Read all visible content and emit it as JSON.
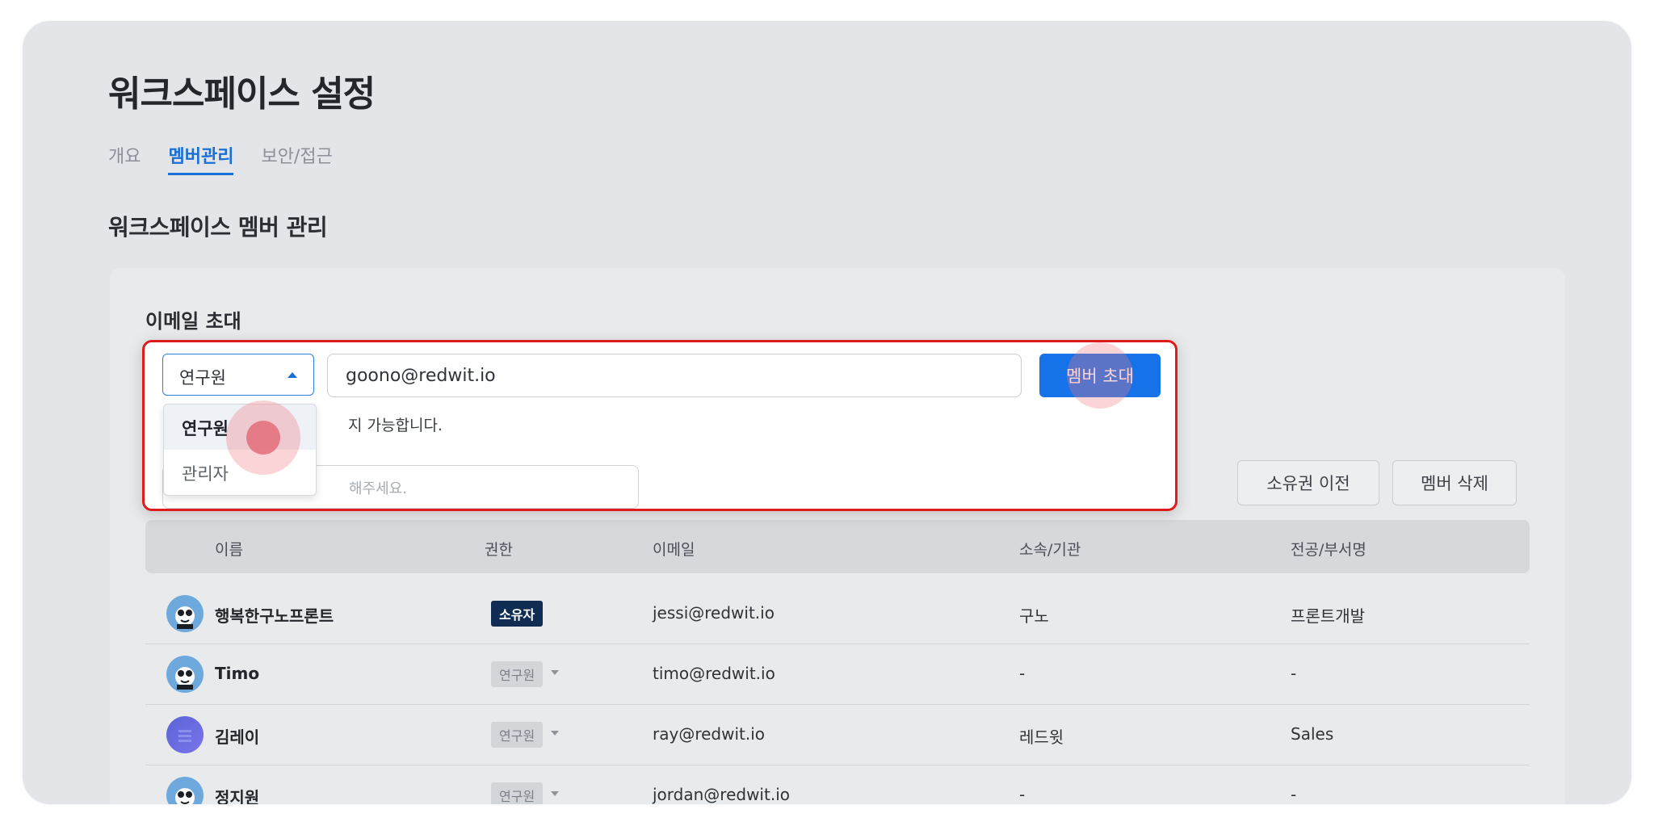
{
  "page": {
    "title": "워크스페이스 설정",
    "tabs": [
      {
        "label": "개요"
      },
      {
        "label": "멤버관리"
      },
      {
        "label": "보안/접근"
      }
    ],
    "section_title": "워크스페이스 멤버 관리"
  },
  "invite": {
    "title": "이메일 초대",
    "role_selected": "연구원",
    "email_value": "goono@redwit.io",
    "invite_button": "멤버 초대",
    "helper_text": "지 가능합니다.",
    "dropdown_options": [
      "연구원",
      "관리자"
    ],
    "search_placeholder_partial": "해주세요."
  },
  "actions": {
    "transfer_owner": "소유권 이전",
    "delete_member": "멤버 삭제"
  },
  "table": {
    "headers": {
      "name": "이름",
      "role": "권한",
      "email": "이메일",
      "org": "소속/기관",
      "dept": "전공/부서명"
    },
    "rows": [
      {
        "name": "행복한구노프론트",
        "role": "소유자",
        "email": "jessi@redwit.io",
        "org": "구노",
        "dept": "프론트개발"
      },
      {
        "name": "Timo",
        "role": "연구원",
        "email": "timo@redwit.io",
        "org": "-",
        "dept": "-"
      },
      {
        "name": "김레이",
        "role": "연구원",
        "email": "ray@redwit.io",
        "org": "레드윗",
        "dept": "Sales"
      },
      {
        "name": "정지원",
        "role": "연구원",
        "email": "jordan@redwit.io",
        "org": "-",
        "dept": "-"
      }
    ]
  },
  "colors": {
    "accent": "#1572e8",
    "highlight_frame": "#e01b1b",
    "owner_badge": "#0f2c52"
  }
}
